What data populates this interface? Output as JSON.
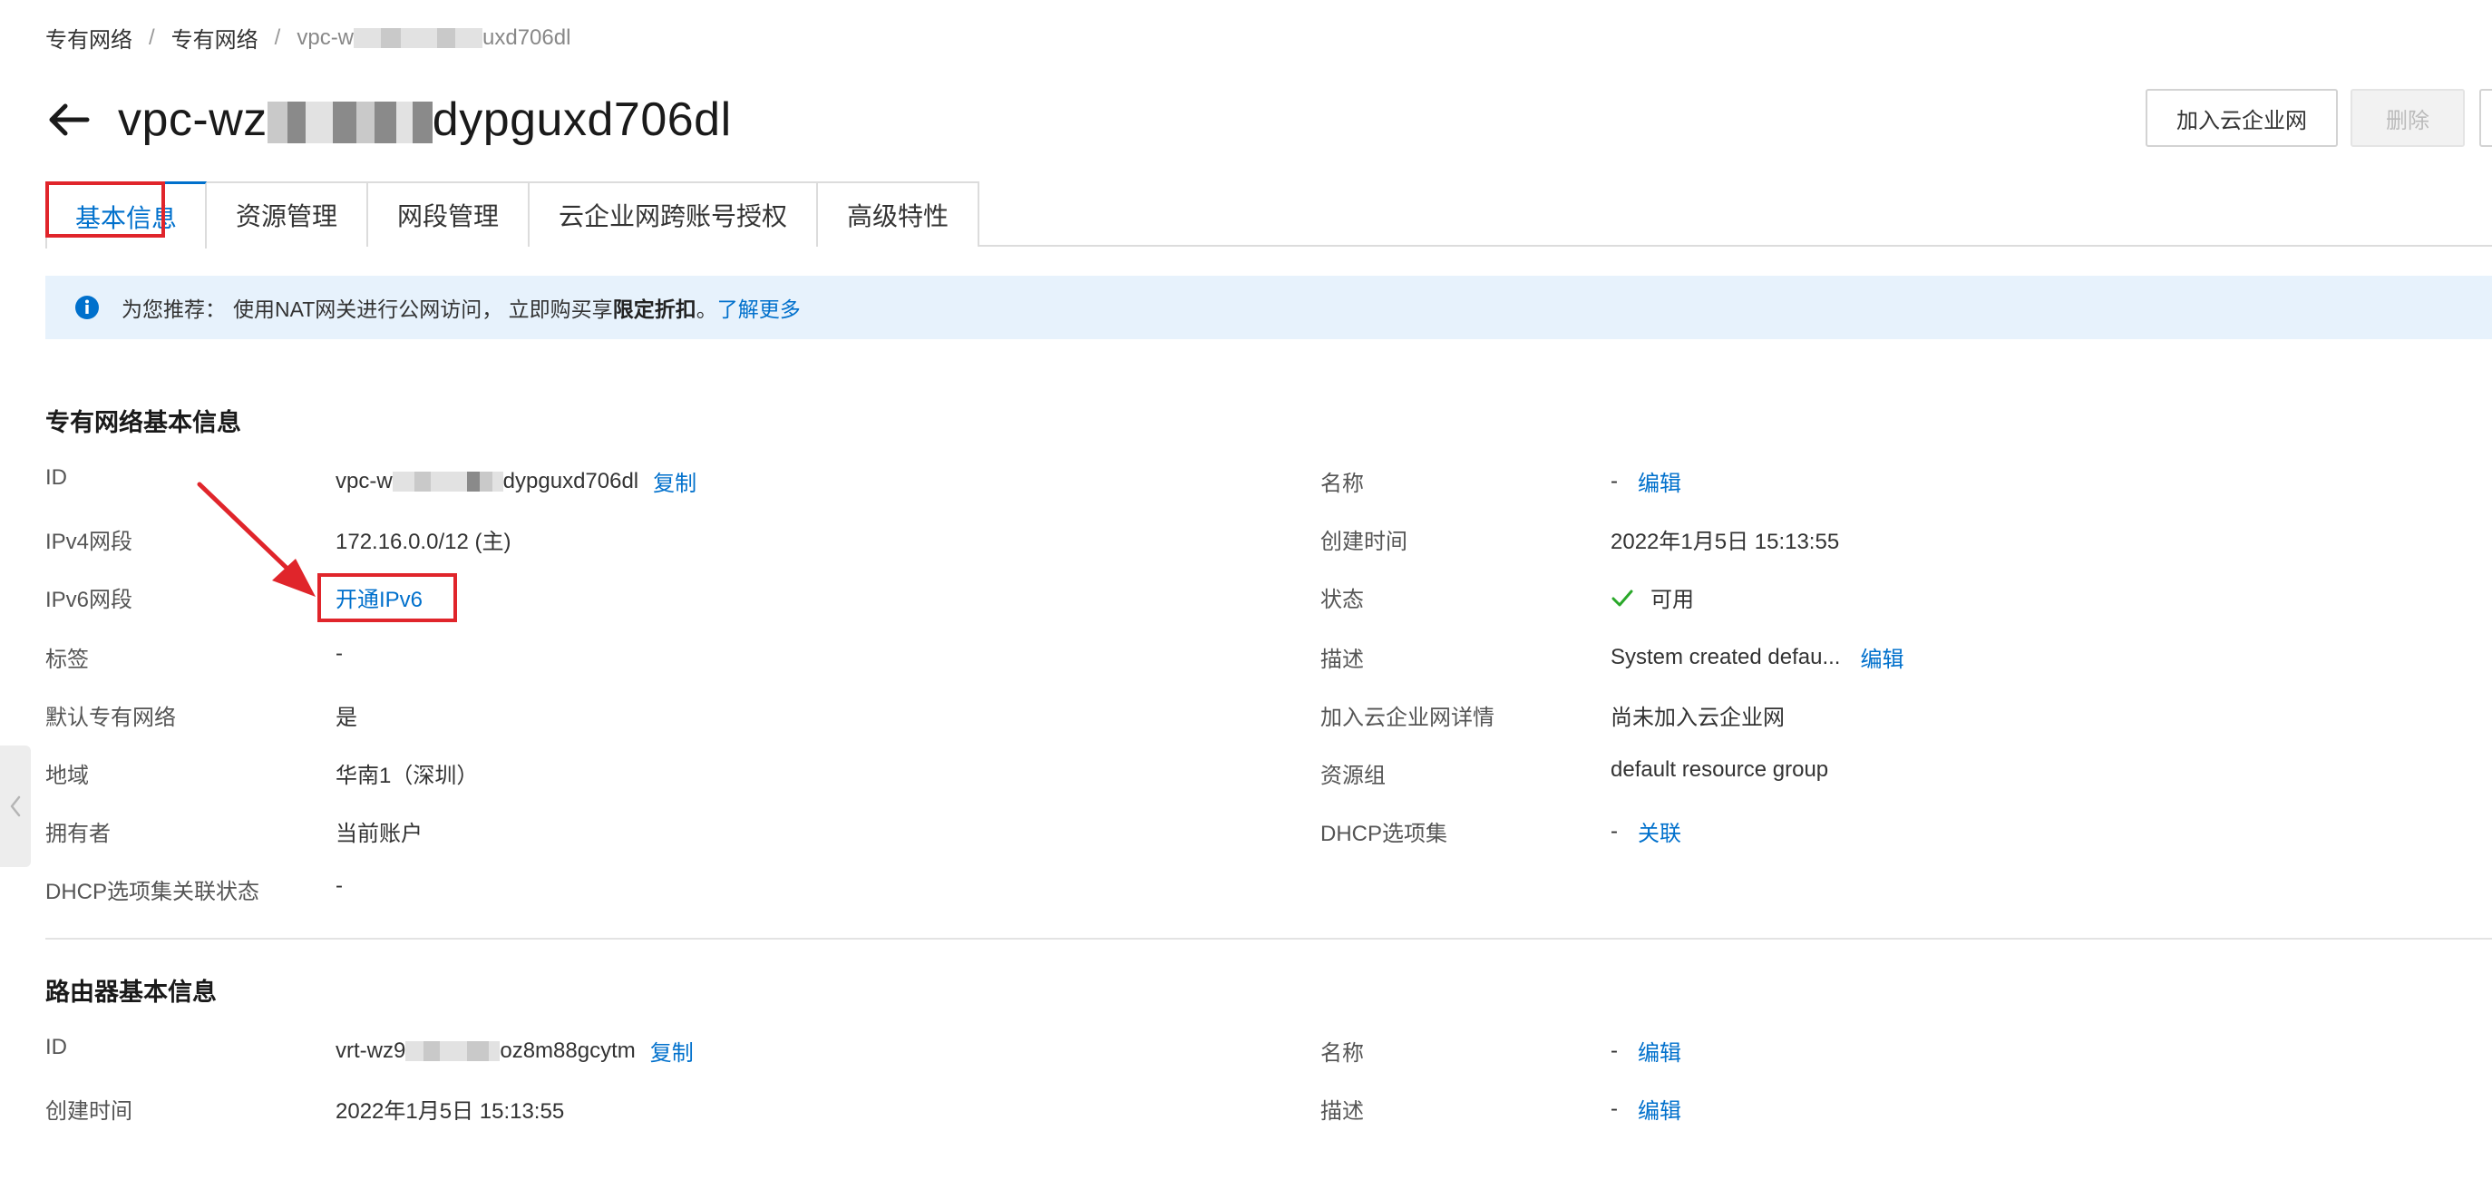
{
  "breadcrumb": {
    "root": "专有网络",
    "parent": "专有网络",
    "sep1": "/",
    "sep2": "/",
    "current_prefix": "vpc-w",
    "current_suffix": "uxd706dl"
  },
  "header": {
    "title_prefix": "vpc-wz",
    "title_suffix": "dypguxd706dl",
    "join_cen_button": "加入云企业网",
    "delete_button": "删除"
  },
  "tabs": [
    "基本信息",
    "资源管理",
    "网段管理",
    "云企业网跨账号授权",
    "高级特性"
  ],
  "notice": {
    "prefix": "为您推荐：",
    "text": "使用NAT网关进行公网访问，  立即购买享",
    "emphasis": "限定折扣",
    "period": "。",
    "link": "了解更多"
  },
  "vpc_section": {
    "title": "专有网络基本信息",
    "left": [
      {
        "label": "ID",
        "value_prefix": "vpc-w",
        "value_suffix": "dypguxd706dl",
        "action": "复制"
      },
      {
        "label": "IPv4网段",
        "value": "172.16.0.0/12 (主)"
      },
      {
        "label": "IPv6网段",
        "link": "开通IPv6"
      },
      {
        "label": "标签",
        "value": "-"
      },
      {
        "label": "默认专有网络",
        "value": "是"
      },
      {
        "label": "地域",
        "value": "华南1（深圳）"
      },
      {
        "label": "拥有者",
        "value": "当前账户"
      },
      {
        "label": "DHCP选项集关联状态",
        "value": "-"
      }
    ],
    "right": [
      {
        "label": "名称",
        "value": "-",
        "action": "编辑"
      },
      {
        "label": "创建时间",
        "value": "2022年1月5日 15:13:55"
      },
      {
        "label": "状态",
        "value": "可用"
      },
      {
        "label": "描述",
        "value": "System created defau...",
        "action": "编辑"
      },
      {
        "label": "加入云企业网详情",
        "value": "尚未加入云企业网"
      },
      {
        "label": "资源组",
        "value": "default resource group"
      },
      {
        "label": "DHCP选项集",
        "value": "-",
        "action": "关联"
      }
    ]
  },
  "router_section": {
    "title": "路由器基本信息",
    "left": [
      {
        "label": "ID",
        "value_prefix": "vrt-wz9",
        "value_suffix": "oz8m88gcytm",
        "action": "复制"
      },
      {
        "label": "创建时间",
        "value": "2022年1月5日 15:13:55"
      }
    ],
    "right": [
      {
        "label": "名称",
        "value": "-",
        "action": "编辑"
      },
      {
        "label": "描述",
        "value": "-",
        "action": "编辑"
      }
    ]
  },
  "colors": {
    "accent": "#0070cc",
    "highlight": "#e0252b",
    "notice_bg": "#e7f2fc",
    "success": "#2aa82a"
  },
  "icons": [
    "back-arrow-icon",
    "info-icon",
    "check-icon",
    "chevron-left-icon"
  ]
}
